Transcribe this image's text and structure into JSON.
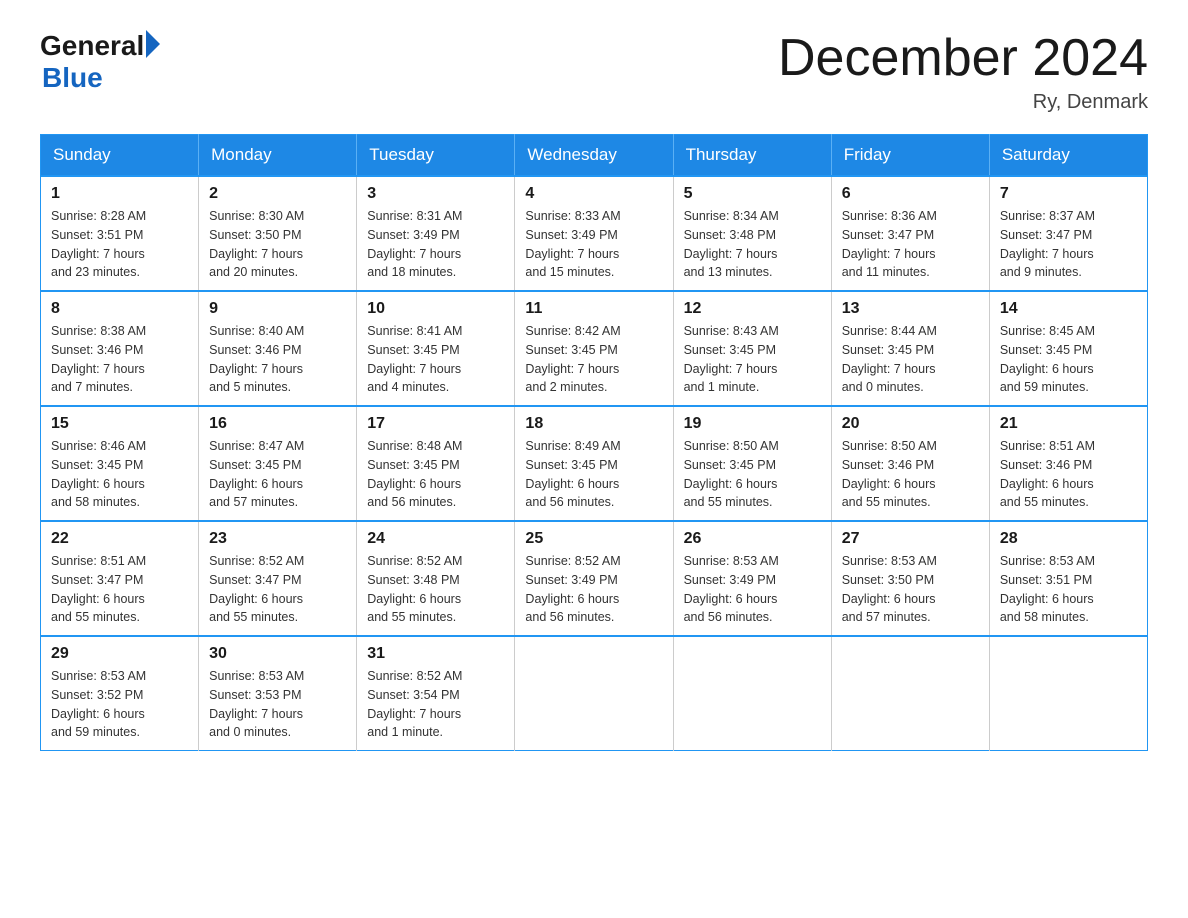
{
  "header": {
    "logo_general": "General",
    "logo_blue": "Blue",
    "month_title": "December 2024",
    "location": "Ry, Denmark"
  },
  "days_of_week": [
    "Sunday",
    "Monday",
    "Tuesday",
    "Wednesday",
    "Thursday",
    "Friday",
    "Saturday"
  ],
  "weeks": [
    [
      {
        "day": "1",
        "sunrise": "Sunrise: 8:28 AM",
        "sunset": "Sunset: 3:51 PM",
        "daylight": "Daylight: 7 hours and 23 minutes."
      },
      {
        "day": "2",
        "sunrise": "Sunrise: 8:30 AM",
        "sunset": "Sunset: 3:50 PM",
        "daylight": "Daylight: 7 hours and 20 minutes."
      },
      {
        "day": "3",
        "sunrise": "Sunrise: 8:31 AM",
        "sunset": "Sunset: 3:49 PM",
        "daylight": "Daylight: 7 hours and 18 minutes."
      },
      {
        "day": "4",
        "sunrise": "Sunrise: 8:33 AM",
        "sunset": "Sunset: 3:49 PM",
        "daylight": "Daylight: 7 hours and 15 minutes."
      },
      {
        "day": "5",
        "sunrise": "Sunrise: 8:34 AM",
        "sunset": "Sunset: 3:48 PM",
        "daylight": "Daylight: 7 hours and 13 minutes."
      },
      {
        "day": "6",
        "sunrise": "Sunrise: 8:36 AM",
        "sunset": "Sunset: 3:47 PM",
        "daylight": "Daylight: 7 hours and 11 minutes."
      },
      {
        "day": "7",
        "sunrise": "Sunrise: 8:37 AM",
        "sunset": "Sunset: 3:47 PM",
        "daylight": "Daylight: 7 hours and 9 minutes."
      }
    ],
    [
      {
        "day": "8",
        "sunrise": "Sunrise: 8:38 AM",
        "sunset": "Sunset: 3:46 PM",
        "daylight": "Daylight: 7 hours and 7 minutes."
      },
      {
        "day": "9",
        "sunrise": "Sunrise: 8:40 AM",
        "sunset": "Sunset: 3:46 PM",
        "daylight": "Daylight: 7 hours and 5 minutes."
      },
      {
        "day": "10",
        "sunrise": "Sunrise: 8:41 AM",
        "sunset": "Sunset: 3:45 PM",
        "daylight": "Daylight: 7 hours and 4 minutes."
      },
      {
        "day": "11",
        "sunrise": "Sunrise: 8:42 AM",
        "sunset": "Sunset: 3:45 PM",
        "daylight": "Daylight: 7 hours and 2 minutes."
      },
      {
        "day": "12",
        "sunrise": "Sunrise: 8:43 AM",
        "sunset": "Sunset: 3:45 PM",
        "daylight": "Daylight: 7 hours and 1 minute."
      },
      {
        "day": "13",
        "sunrise": "Sunrise: 8:44 AM",
        "sunset": "Sunset: 3:45 PM",
        "daylight": "Daylight: 7 hours and 0 minutes."
      },
      {
        "day": "14",
        "sunrise": "Sunrise: 8:45 AM",
        "sunset": "Sunset: 3:45 PM",
        "daylight": "Daylight: 6 hours and 59 minutes."
      }
    ],
    [
      {
        "day": "15",
        "sunrise": "Sunrise: 8:46 AM",
        "sunset": "Sunset: 3:45 PM",
        "daylight": "Daylight: 6 hours and 58 minutes."
      },
      {
        "day": "16",
        "sunrise": "Sunrise: 8:47 AM",
        "sunset": "Sunset: 3:45 PM",
        "daylight": "Daylight: 6 hours and 57 minutes."
      },
      {
        "day": "17",
        "sunrise": "Sunrise: 8:48 AM",
        "sunset": "Sunset: 3:45 PM",
        "daylight": "Daylight: 6 hours and 56 minutes."
      },
      {
        "day": "18",
        "sunrise": "Sunrise: 8:49 AM",
        "sunset": "Sunset: 3:45 PM",
        "daylight": "Daylight: 6 hours and 56 minutes."
      },
      {
        "day": "19",
        "sunrise": "Sunrise: 8:50 AM",
        "sunset": "Sunset: 3:45 PM",
        "daylight": "Daylight: 6 hours and 55 minutes."
      },
      {
        "day": "20",
        "sunrise": "Sunrise: 8:50 AM",
        "sunset": "Sunset: 3:46 PM",
        "daylight": "Daylight: 6 hours and 55 minutes."
      },
      {
        "day": "21",
        "sunrise": "Sunrise: 8:51 AM",
        "sunset": "Sunset: 3:46 PM",
        "daylight": "Daylight: 6 hours and 55 minutes."
      }
    ],
    [
      {
        "day": "22",
        "sunrise": "Sunrise: 8:51 AM",
        "sunset": "Sunset: 3:47 PM",
        "daylight": "Daylight: 6 hours and 55 minutes."
      },
      {
        "day": "23",
        "sunrise": "Sunrise: 8:52 AM",
        "sunset": "Sunset: 3:47 PM",
        "daylight": "Daylight: 6 hours and 55 minutes."
      },
      {
        "day": "24",
        "sunrise": "Sunrise: 8:52 AM",
        "sunset": "Sunset: 3:48 PM",
        "daylight": "Daylight: 6 hours and 55 minutes."
      },
      {
        "day": "25",
        "sunrise": "Sunrise: 8:52 AM",
        "sunset": "Sunset: 3:49 PM",
        "daylight": "Daylight: 6 hours and 56 minutes."
      },
      {
        "day": "26",
        "sunrise": "Sunrise: 8:53 AM",
        "sunset": "Sunset: 3:49 PM",
        "daylight": "Daylight: 6 hours and 56 minutes."
      },
      {
        "day": "27",
        "sunrise": "Sunrise: 8:53 AM",
        "sunset": "Sunset: 3:50 PM",
        "daylight": "Daylight: 6 hours and 57 minutes."
      },
      {
        "day": "28",
        "sunrise": "Sunrise: 8:53 AM",
        "sunset": "Sunset: 3:51 PM",
        "daylight": "Daylight: 6 hours and 58 minutes."
      }
    ],
    [
      {
        "day": "29",
        "sunrise": "Sunrise: 8:53 AM",
        "sunset": "Sunset: 3:52 PM",
        "daylight": "Daylight: 6 hours and 59 minutes."
      },
      {
        "day": "30",
        "sunrise": "Sunrise: 8:53 AM",
        "sunset": "Sunset: 3:53 PM",
        "daylight": "Daylight: 7 hours and 0 minutes."
      },
      {
        "day": "31",
        "sunrise": "Sunrise: 8:52 AM",
        "sunset": "Sunset: 3:54 PM",
        "daylight": "Daylight: 7 hours and 1 minute."
      },
      null,
      null,
      null,
      null
    ]
  ]
}
